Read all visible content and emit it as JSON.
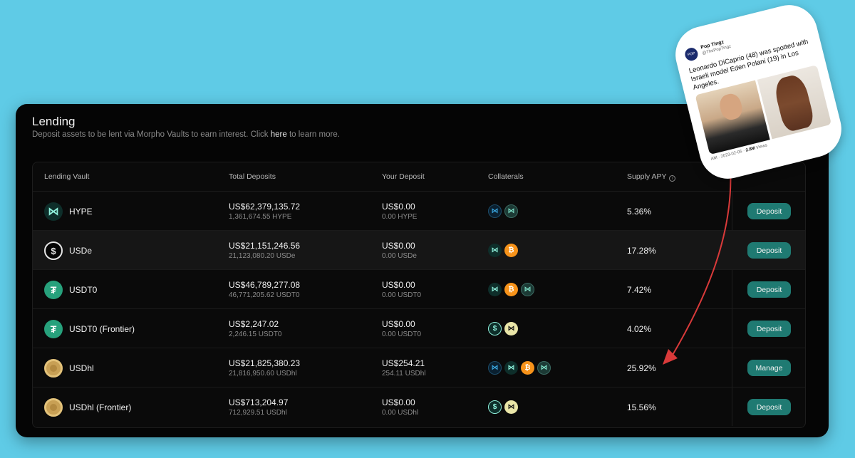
{
  "header": {
    "title": "Lending",
    "subtitle_before": "Deposit assets to be lent via Morpho Vaults to earn interest. Click ",
    "subtitle_link": "here",
    "subtitle_after": " to learn more."
  },
  "table": {
    "columns": [
      "Lending Vault",
      "Total Deposits",
      "Your Deposit",
      "Collaterals",
      "Supply APY"
    ],
    "rows": [
      {
        "name": "HYPE",
        "icon": "hype-icon",
        "total_usd": "US$62,379,135.72",
        "total_token": "1,361,674.55 HYPE",
        "your_usd": "US$0.00",
        "your_token": "0.00 HYPE",
        "collaterals": [
          "khype-icon",
          "whype-icon"
        ],
        "apy": "5.36%",
        "action": "Deposit"
      },
      {
        "name": "USDe",
        "icon": "usde-icon",
        "total_usd": "US$21,151,246.56",
        "total_token": "21,123,080.20 USDe",
        "your_usd": "US$0.00",
        "your_token": "0.00 USDe",
        "collaterals": [
          "hype-icon",
          "btc-icon"
        ],
        "apy": "17.28%",
        "action": "Deposit"
      },
      {
        "name": "USDT0",
        "icon": "usdt0-icon",
        "total_usd": "US$46,789,277.08",
        "total_token": "46,771,205.62 USDT0",
        "your_usd": "US$0.00",
        "your_token": "0.00 USDT0",
        "collaterals": [
          "hype-icon",
          "btc-icon",
          "whype-icon"
        ],
        "apy": "7.42%",
        "action": "Deposit"
      },
      {
        "name": "USDT0 (Frontier)",
        "icon": "usdt0-icon",
        "total_usd": "US$2,247.02",
        "total_token": "2,246.15 USDT0",
        "your_usd": "US$0.00",
        "your_token": "0.00 USDT0",
        "collaterals": [
          "dollar-icon",
          "hy-icon"
        ],
        "apy": "4.02%",
        "action": "Deposit"
      },
      {
        "name": "USDhl",
        "icon": "usdhl-icon",
        "total_usd": "US$21,825,380.23",
        "total_token": "21,816,950.60 USDhl",
        "your_usd": "US$254.21",
        "your_token": "254.11 USDhl",
        "collaterals": [
          "khype-icon",
          "hype-icon",
          "btc-icon",
          "whype-icon"
        ],
        "apy": "25.92%",
        "action": "Manage"
      },
      {
        "name": "USDhl (Frontier)",
        "icon": "usdhl-icon",
        "total_usd": "US$713,204.97",
        "total_token": "712,929.51 USDhl",
        "your_usd": "US$0.00",
        "your_token": "0.00 USDhl",
        "collaterals": [
          "dollar-icon",
          "hy-icon"
        ],
        "apy": "15.56%",
        "action": "Deposit"
      }
    ]
  },
  "tweet": {
    "name": "Pop Tingz",
    "handle": "@ThePopTingz",
    "avatar_text": "POP",
    "text": "Leonardo DiCaprio (48) was spotted with Israeli model Eden Polani (19) in Los Angeles.",
    "meta_prefix": "AM · 2023-02-05 · ",
    "views": "2.8M",
    "views_label": " Views"
  },
  "colors": {
    "background": "#5fcbe6",
    "panel": "#050505",
    "button": "#1f7a72",
    "arrow": "#d93a3a"
  }
}
